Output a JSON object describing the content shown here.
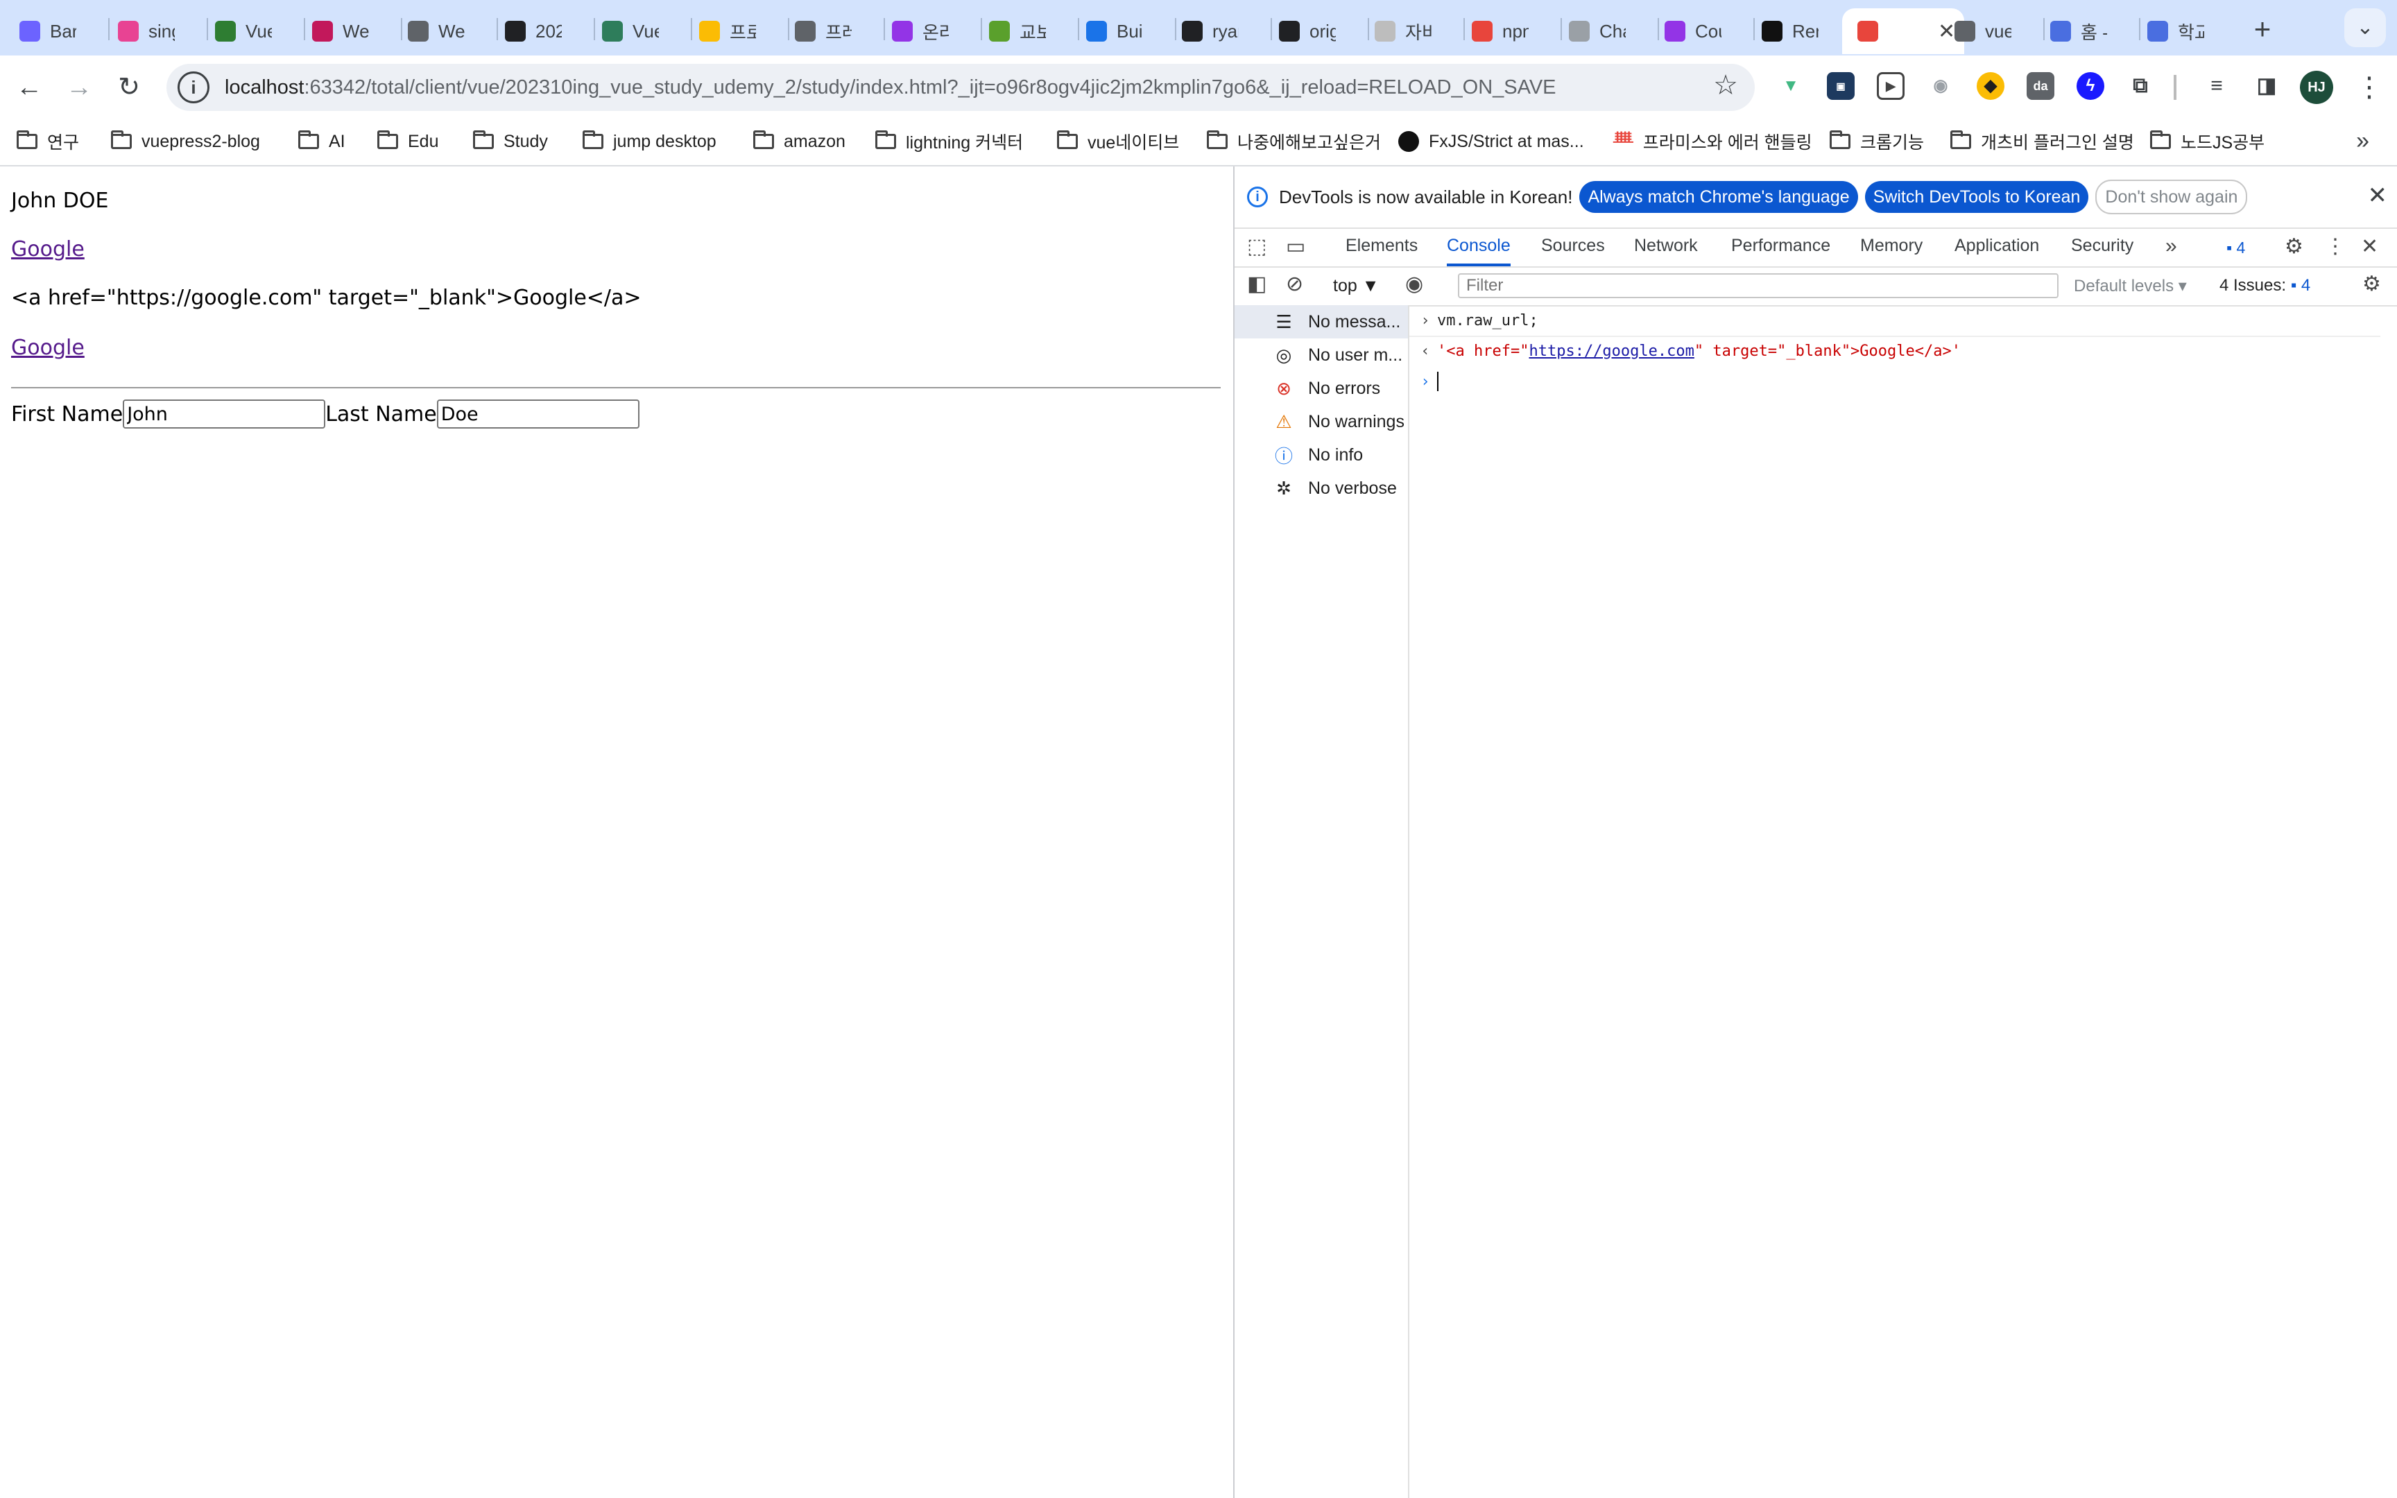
{
  "browser": {
    "tabs": [
      {
        "title": "Barc",
        "fav": "#6c63ff"
      },
      {
        "title": "sing",
        "fav": "#e84393"
      },
      {
        "title": "Vue",
        "fav": "#2e7d32"
      },
      {
        "title": "Web",
        "fav": "#c2185b"
      },
      {
        "title": "Web",
        "fav": "#5f6368"
      },
      {
        "title": "202",
        "fav": "#202124"
      },
      {
        "title": "Vue",
        "fav": "#2e7d5b"
      },
      {
        "title": "프로",
        "fav": "#fbbc04"
      },
      {
        "title": "프레",
        "fav": "#5f6368"
      },
      {
        "title": "온라",
        "fav": "#9334e6"
      },
      {
        "title": "교보",
        "fav": "#5aa02c"
      },
      {
        "title": "Buil",
        "fav": "#1a73e8"
      },
      {
        "title": "ryan",
        "fav": "#202124"
      },
      {
        "title": "orig",
        "fav": "#202124"
      },
      {
        "title": "자비",
        "fav": "#bdbdbd"
      },
      {
        "title": "npn",
        "fav": "#e8453c"
      },
      {
        "title": "Cha",
        "fav": "#9aa0a6"
      },
      {
        "title": "Cou",
        "fav": "#9334e6"
      },
      {
        "title": "Ren",
        "fav": "#111111"
      },
      {
        "title": "",
        "fav": "#e8453c"
      },
      {
        "title": "vue",
        "fav": "#5f6368"
      },
      {
        "title": "홈 -",
        "fav": "#4a6ee0"
      },
      {
        "title": "학교",
        "fav": "#4a6ee0"
      }
    ],
    "new_tab": "+",
    "tab_search": "⌄",
    "url_host": "localhost",
    "url_rest": ":63342/total/client/vue/202310ing_vue_study_udemy_2/study/index.html?_ijt=o96r8ogv4jic2jm2kmplin7go6&_ij_reload=RELOAD_ON_SAVE",
    "profile_initials": "HJ",
    "bookmarks": [
      {
        "label": "연구",
        "type": "folder"
      },
      {
        "label": "vuepress2-blog",
        "type": "folder"
      },
      {
        "label": "AI",
        "type": "folder"
      },
      {
        "label": "Edu",
        "type": "folder"
      },
      {
        "label": "Study",
        "type": "folder"
      },
      {
        "label": "jump desktop",
        "type": "folder"
      },
      {
        "label": "amazon",
        "type": "folder"
      },
      {
        "label": "lightning 커넥터",
        "type": "folder"
      },
      {
        "label": "vue네이티브",
        "type": "folder"
      },
      {
        "label": "나중에해보고싶은거",
        "type": "folder"
      },
      {
        "label": "FxJS/Strict at mas...",
        "type": "github"
      },
      {
        "label": "프라미스와 에러 핸들링",
        "type": "page"
      },
      {
        "label": "크롬기능",
        "type": "folder"
      },
      {
        "label": "개츠비 플러그인 설명",
        "type": "folder"
      },
      {
        "label": "노드JS공부",
        "type": "folder"
      }
    ]
  },
  "page": {
    "full_name": "John DOE",
    "link1": "Google",
    "raw_html_text": "<a href=\"https://google.com\" target=\"_blank\">Google</a>",
    "link2": "Google",
    "first_name_label": "First Name",
    "first_name_value": "John",
    "last_name_label": "Last Name",
    "last_name_value": "Doe"
  },
  "devtools": {
    "info_text": "DevTools is now available in Korean!",
    "btn_match": "Always match Chrome's language",
    "btn_switch": "Switch DevTools to Korean",
    "btn_dont_show": "Don't show again",
    "tabs": [
      "Elements",
      "Console",
      "Sources",
      "Network",
      "Performance",
      "Memory",
      "Application",
      "Security"
    ],
    "issues_badge": "4",
    "context": "top",
    "filter_placeholder": "Filter",
    "levels": "Default levels",
    "issues_label": "4 Issues:",
    "issues_count": "4",
    "sidebar": [
      "No messa...",
      "No user m...",
      "No errors",
      "No warnings",
      "No info",
      "No verbose"
    ],
    "console_input": "vm.raw_url;",
    "result_q1": "'",
    "result_p1": "<a href=\"",
    "result_link": "https://google.com",
    "result_p2": "\" target=\"_blank\">Google</a>",
    "result_q2": "'"
  }
}
